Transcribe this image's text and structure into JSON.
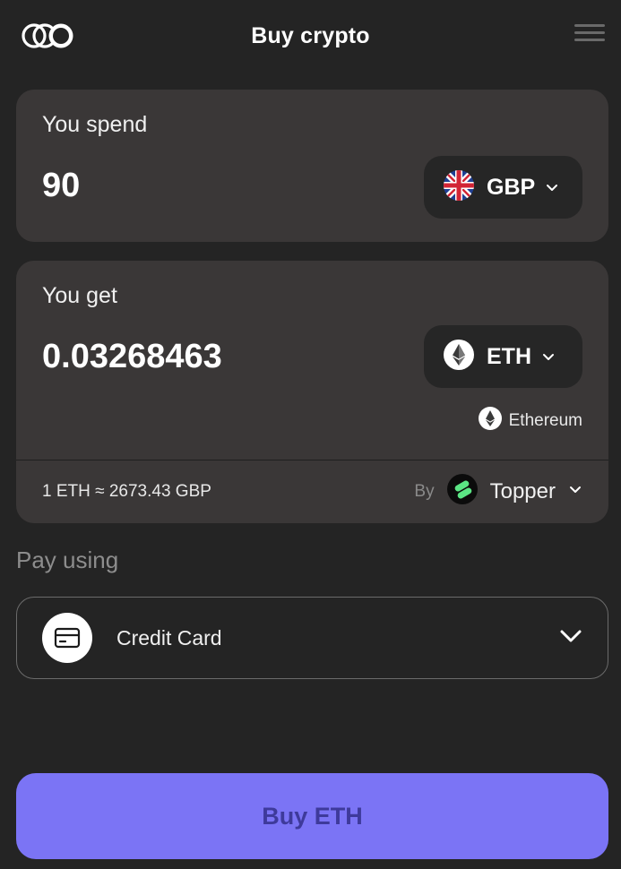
{
  "header": {
    "title": "Buy crypto"
  },
  "spend": {
    "label": "You spend",
    "amount": "90",
    "currency": "GBP",
    "currency_icon": "uk-flag-icon"
  },
  "get": {
    "label": "You get",
    "amount": "0.03268463",
    "currency": "ETH",
    "currency_icon": "ethereum-icon",
    "network": "Ethereum"
  },
  "quote": {
    "rate": "1 ETH ≈ 2673.43 GBP",
    "by_label": "By",
    "provider": "Topper"
  },
  "payment": {
    "label": "Pay using",
    "method": "Credit Card",
    "method_icon": "credit-card-icon"
  },
  "cta": {
    "label": "Buy ETH"
  },
  "colors": {
    "background": "#242424",
    "card": "#3a3737",
    "pill": "#262626",
    "accent": "#7b74f5",
    "accent_text": "#3e3a9b",
    "provider_green": "#5be584"
  }
}
